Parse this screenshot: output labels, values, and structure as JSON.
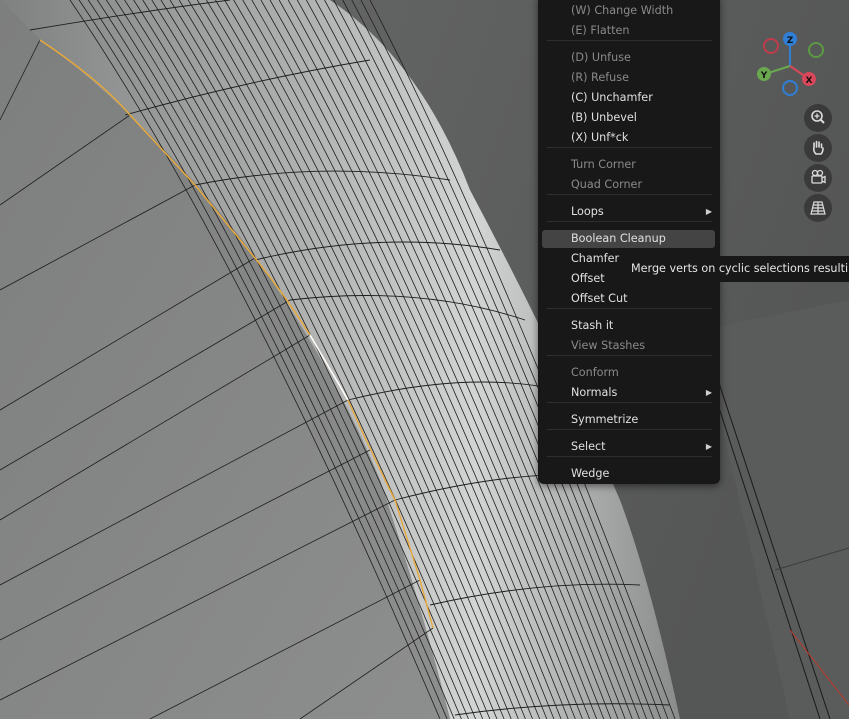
{
  "menu": {
    "items": [
      {
        "label": "(W) Change Width",
        "disabled": true
      },
      {
        "label": "(E) Flatten",
        "disabled": true
      },
      {
        "label": "(D) Unfuse",
        "disabled": true
      },
      {
        "label": "(R) Refuse",
        "disabled": true
      },
      {
        "label": "(C) Unchamfer",
        "disabled": false
      },
      {
        "label": "(B) Unbevel",
        "disabled": false
      },
      {
        "label": "(X) Unf*ck",
        "disabled": false
      },
      {
        "label": "Turn Corner",
        "disabled": true
      },
      {
        "label": "Quad Corner",
        "disabled": true
      },
      {
        "label": "Loops",
        "disabled": false,
        "submenu": true
      },
      {
        "label": "Boolean Cleanup",
        "disabled": false,
        "highlighted": true
      },
      {
        "label": "Chamfer",
        "disabled": false
      },
      {
        "label": "Offset",
        "disabled": false
      },
      {
        "label": "Offset Cut",
        "disabled": false
      },
      {
        "label": "Stash it",
        "disabled": false
      },
      {
        "label": "View Stashes",
        "disabled": true
      },
      {
        "label": "Conform",
        "disabled": true
      },
      {
        "label": "Normals",
        "disabled": false,
        "submenu": true
      },
      {
        "label": "Symmetrize",
        "disabled": false
      },
      {
        "label": "Select",
        "disabled": false,
        "submenu": true
      },
      {
        "label": "Wedge",
        "disabled": false
      }
    ],
    "submenu_arrow": "▶"
  },
  "tooltip": {
    "text": "Merge verts on cyclic selections resulting"
  },
  "gizmo": {
    "axes": [
      {
        "label": "Z",
        "color": "#2f7fd6"
      },
      {
        "label": "Y",
        "color": "#6aa84f"
      },
      {
        "label": "X",
        "color": "#d9485a"
      }
    ]
  },
  "view_buttons": [
    {
      "icon": "zoom-icon"
    },
    {
      "icon": "pan-hand-icon"
    },
    {
      "icon": "camera-icon"
    },
    {
      "icon": "ortho-grid-icon"
    }
  ],
  "colors": {
    "selected_edge": "#e8a93a",
    "active_edge": "#ffffff",
    "x_axis_line": "#c0392b"
  }
}
